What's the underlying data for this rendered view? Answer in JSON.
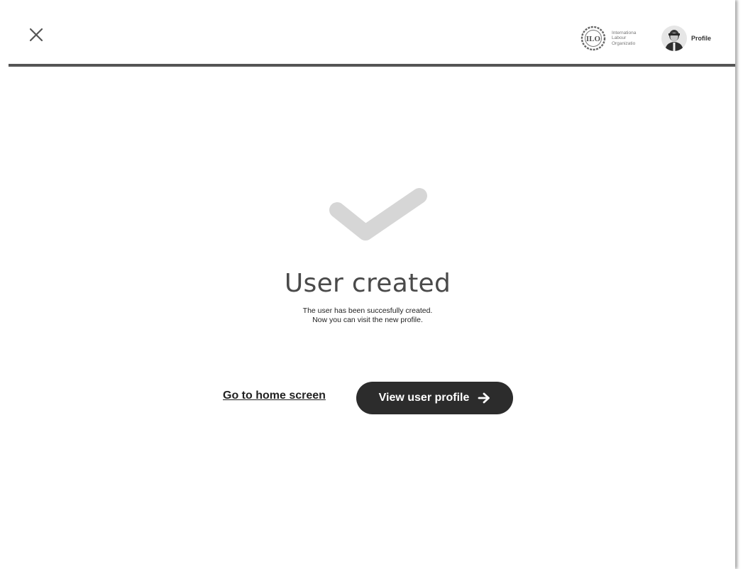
{
  "header": {
    "close_icon": "close-icon",
    "logo": {
      "icon": "ilo-emblem-icon",
      "emblem_text": "ILO",
      "lines": [
        "Internationa",
        "Labour",
        "Organizatio"
      ]
    },
    "profile": {
      "icon": "avatar",
      "label": "Profile"
    }
  },
  "main": {
    "icon": "checkmark-icon",
    "title": "User created",
    "subtitle_line1": "The user has been succesfully created.",
    "subtitle_line2": "Now you can visit the new profile.",
    "home_link": "Go to home screen",
    "view_button": "View user profile",
    "view_button_icon": "arrow-right-icon"
  },
  "colors": {
    "primary_button": "#2c2c2c",
    "checkmark": "#d6d6d6",
    "divider": "#555555"
  }
}
